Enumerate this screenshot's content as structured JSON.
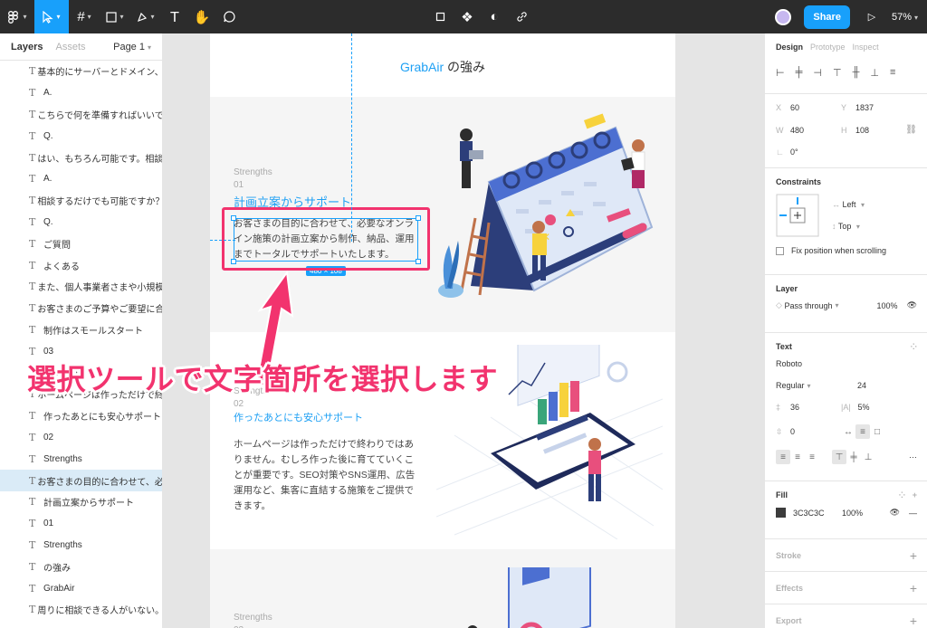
{
  "toolbar": {
    "zoom": "57%",
    "share_label": "Share",
    "tools": [
      "figma-menu-icon",
      "move-icon",
      "frame-icon",
      "shape-icon",
      "pen-icon",
      "text-icon",
      "hand-icon",
      "comment-icon"
    ],
    "accent": "#18a0fb"
  },
  "left_panel": {
    "tab_layers": "Layers",
    "tab_assets": "Assets",
    "page": "Page 1",
    "layers": [
      {
        "label": "基本的にサーバーとドメイン、..."
      },
      {
        "label": "A."
      },
      {
        "label": "こちらで何を準備すればいいで..."
      },
      {
        "label": "Q."
      },
      {
        "label": "はい、もちろん可能です。相談..."
      },
      {
        "label": "A."
      },
      {
        "label": "相談するだけでも可能ですか？"
      },
      {
        "label": "Q."
      },
      {
        "label": "ご質問"
      },
      {
        "label": "よくある"
      },
      {
        "label": "また、個人事業者さまや小規模..."
      },
      {
        "label": "お客さまのご予算やご要望に合..."
      },
      {
        "label": "制作はスモールスタート"
      },
      {
        "label": "03"
      },
      {
        "label": "Strengths"
      },
      {
        "label": "ホームページは作っただけで終..."
      },
      {
        "label": "作ったあとにも安心サポート"
      },
      {
        "label": "02"
      },
      {
        "label": "Strengths"
      },
      {
        "label": "お客さまの目的に合わせて、必..."
      },
      {
        "label": "計画立案からサポート"
      },
      {
        "label": "01"
      },
      {
        "label": "Strengths"
      },
      {
        "label": "の強み"
      },
      {
        "label": "GrabAir"
      },
      {
        "label": "周りに相談できる人がいない。..."
      }
    ],
    "selected_index": 19
  },
  "canvas": {
    "section_brand": "GrabAir",
    "section_suffix": " の強み",
    "block1": {
      "label": "Strengths",
      "num": "01",
      "heading": "計画立案からサポート",
      "paragraph": "お客さまの目的に合わせて、必要なオンライン施策の計画立案から制作、納品、運用までトータルでサポートいたします。",
      "size_label": "480 × 108"
    },
    "block2": {
      "label": "Strengths",
      "num": "02",
      "heading": "作ったあとにも安心サポート",
      "paragraph": "ホームページは作っただけで終わりではありません。むしろ作った後に育てていくことが重要です。SEO対策やSNS運用、広告運用など、集客に直結する施策をご提供できます。"
    },
    "block3": {
      "label": "Strengths",
      "num": "03"
    },
    "annotation": "選択ツールで文字箇所を選択します",
    "annotation_color": "#f2336e"
  },
  "right_panel": {
    "tabs": [
      "Design",
      "Prototype",
      "Inspect"
    ],
    "x_label": "X",
    "x": "60",
    "y_label": "Y",
    "y": "1837",
    "w_label": "W",
    "w": "480",
    "h_label": "H",
    "h": "108",
    "rotation": "0°",
    "constraints_title": "Constraints",
    "constraint_h": "Left",
    "constraint_v": "Top",
    "fix_position": "Fix position when scrolling",
    "layer_title": "Layer",
    "blend": "Pass through",
    "opacity": "100%",
    "text_title": "Text",
    "font_family": "Roboto",
    "font_weight": "Regular",
    "font_size": "24",
    "line_height": "36",
    "letter_spacing": "5%",
    "paragraph_spacing": "0",
    "fill_title": "Fill",
    "fill_hex": "3C3C3C",
    "fill_opacity": "100%",
    "stroke_title": "Stroke",
    "effects_title": "Effects",
    "export_title": "Export"
  }
}
